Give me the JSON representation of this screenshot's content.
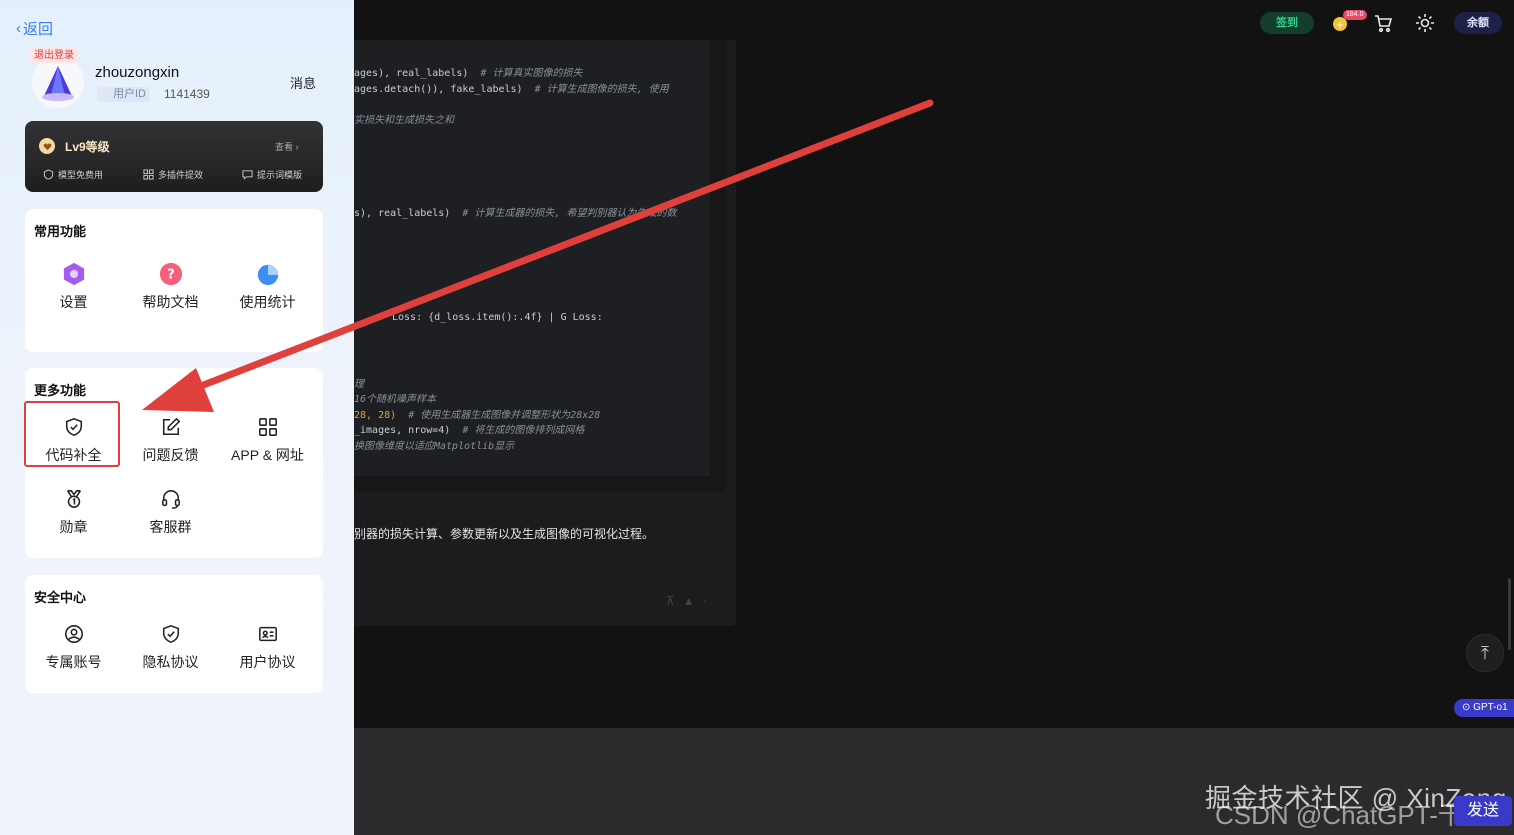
{
  "header": {
    "signin_label": "签到",
    "coin_badge": "184.0",
    "balance_label": "余额",
    "icons": [
      "coin-icon",
      "cart-icon",
      "sun-icon"
    ]
  },
  "code": {
    "lines": [
      {
        "code": "ages), real_labels)  ",
        "comment": "# 计算真实图像的损失"
      },
      {
        "code": "ages.detach()), fake_labels)  ",
        "comment": "# 计算生成图像的损失, 使用"
      },
      {
        "code": "",
        "comment": "实损失和生成损失之和"
      },
      {
        "code": "s), real_labels)  ",
        "comment": "# 计算生成器的损失, 希望判别器认为生成的数"
      },
      {
        "code": "Loss: {d_loss.item():.4f} | G Loss:",
        "comment": ""
      },
      {
        "code": "",
        "comment": "理"
      },
      {
        "code": "",
        "comment": "16个随机噪声样本"
      },
      {
        "code": "28, 28)  ",
        "comment": "# 使用生成器生成图像并调整形状为28x28"
      },
      {
        "code": "_images, nrow=4)  ",
        "comment": "# 将生成的图像排列成网格"
      },
      {
        "code": "",
        "comment": "换图像维度以适应Matplotlib显示"
      }
    ]
  },
  "chat": {
    "summary": "别器的损失计算、参数更新以及生成图像的可视化过程。"
  },
  "model_badge": "GPT-o1",
  "watermark": {
    "line1": "掘金技术社区 @ XinZong",
    "line2": "CSDN @ChatGPT-千鑫"
  },
  "send_button": "发送",
  "drawer": {
    "back_label": "返回",
    "logout_label": "退出登录",
    "username": "zhouzongxin",
    "uid_label": "用户ID",
    "uid_value": "1141439",
    "messages_label": "消息",
    "level": {
      "title": "Lv9等级",
      "view_label": "查看",
      "features": [
        "模型免费用",
        "多插件提效",
        "提示词模版"
      ]
    },
    "common": {
      "title": "常用功能",
      "items": [
        {
          "label": "设置",
          "icon": "hexagon-settings-icon"
        },
        {
          "label": "帮助文档",
          "icon": "help-question-icon"
        },
        {
          "label": "使用统计",
          "icon": "pie-chart-icon"
        }
      ]
    },
    "more": {
      "title": "更多功能",
      "items": [
        {
          "label": "代码补全",
          "icon": "shield-check-icon"
        },
        {
          "label": "问题反馈",
          "icon": "edit-icon"
        },
        {
          "label": "APP & 网址",
          "icon": "grid-icon"
        },
        {
          "label": "勋章",
          "icon": "medal-icon"
        },
        {
          "label": "客服群",
          "icon": "headset-icon"
        }
      ]
    },
    "security": {
      "title": "安全中心",
      "items": [
        {
          "label": "专属账号",
          "icon": "user-circle-icon"
        },
        {
          "label": "隐私协议",
          "icon": "shield-check-icon"
        },
        {
          "label": "用户协议",
          "icon": "id-card-icon"
        }
      ]
    }
  },
  "annotation": {
    "highlight_color": "#e0403b"
  }
}
